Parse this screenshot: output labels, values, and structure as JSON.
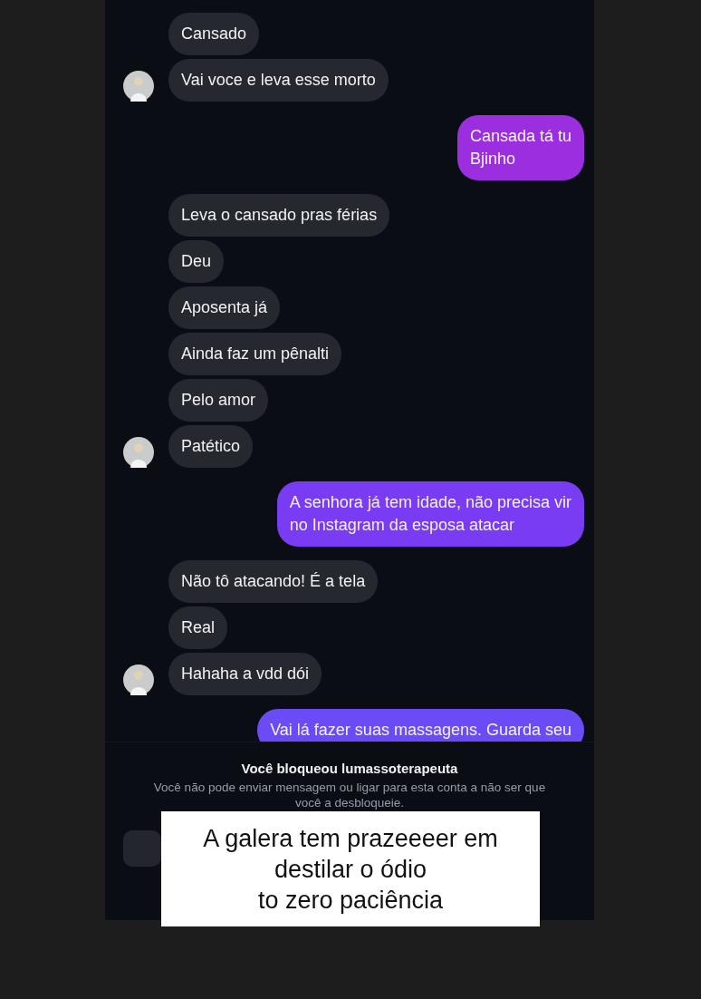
{
  "messages": [
    {
      "kind": "received",
      "text": "Cansado",
      "avatar": false
    },
    {
      "kind": "received",
      "text": "Vai voce e leva esse morto",
      "avatar": true
    },
    {
      "kind": "sent",
      "text": "Cansada tá tu\nBjinho",
      "color": "#9b2fe0"
    },
    {
      "kind": "received",
      "text": "Leva o cansado pras férias",
      "avatar": false
    },
    {
      "kind": "received",
      "text": "Deu",
      "avatar": false
    },
    {
      "kind": "received",
      "text": "Aposenta já",
      "avatar": false
    },
    {
      "kind": "received",
      "text": "Ainda faz um pênalti",
      "avatar": false
    },
    {
      "kind": "received",
      "text": "Pelo amor",
      "avatar": false
    },
    {
      "kind": "received",
      "text": "Patético",
      "avatar": true
    },
    {
      "kind": "sent",
      "text": "A senhora já tem idade, não precisa vir\nno Instagram da esposa atacar",
      "color": "#7a3cf2"
    },
    {
      "kind": "received",
      "text": "Não tô atacando! É a tela",
      "avatar": false
    },
    {
      "kind": "received",
      "text": "Real",
      "avatar": false
    },
    {
      "kind": "received",
      "text": "Hahaha a vdd dói",
      "avatar": true
    },
    {
      "kind": "sent",
      "text": "Vai lá fazer suas massagens. Guarda seu",
      "color": "#6b4bf5"
    }
  ],
  "blocked_notice": {
    "title": "Você bloqueou lumassoterapeuta",
    "body": "Você não pode enviar mensagem ou ligar para esta conta a não ser que você a desbloqueie."
  },
  "caption": [
    "A galera tem prazeeeer em",
    "destilar o ódio",
    "to zero paciência"
  ]
}
